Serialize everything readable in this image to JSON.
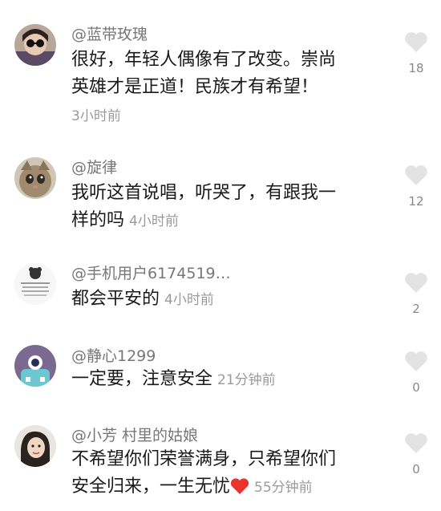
{
  "comments": [
    {
      "username": "@蓝带玫瑰",
      "text_line1": "很好，年轻人偶像有了改变。崇尚",
      "text_line2": "英雄才是正道！民族才有希望！",
      "time": "3小时前",
      "likes": "18"
    },
    {
      "username": "@旋律",
      "text_line1": "我听这首说唱，听哭了，有跟我一",
      "text_line2": "样的吗",
      "time": "4小时前",
      "likes": "12"
    },
    {
      "username": "@手机用户6174519…",
      "text_line1": "都会平安的",
      "time": "4小时前",
      "likes": "2"
    },
    {
      "username": "@静心1299",
      "text_line1": "一定要，注意安全",
      "time": "21分钟前",
      "likes": "0"
    },
    {
      "username": "@小芳 村里的姑娘",
      "text_line1": "不希望你们荣誉满身，只希望你们",
      "text_line2": "安全归来，一生无忧",
      "time": "55分钟前",
      "likes": "0"
    }
  ],
  "colors": {
    "like_icon": "#e3e3e3",
    "heart_emoji": "#e8332e",
    "time_text": "#9a9a9a"
  },
  "icons": {
    "like": "heart-icon",
    "emoji": "red-heart-emoji"
  }
}
